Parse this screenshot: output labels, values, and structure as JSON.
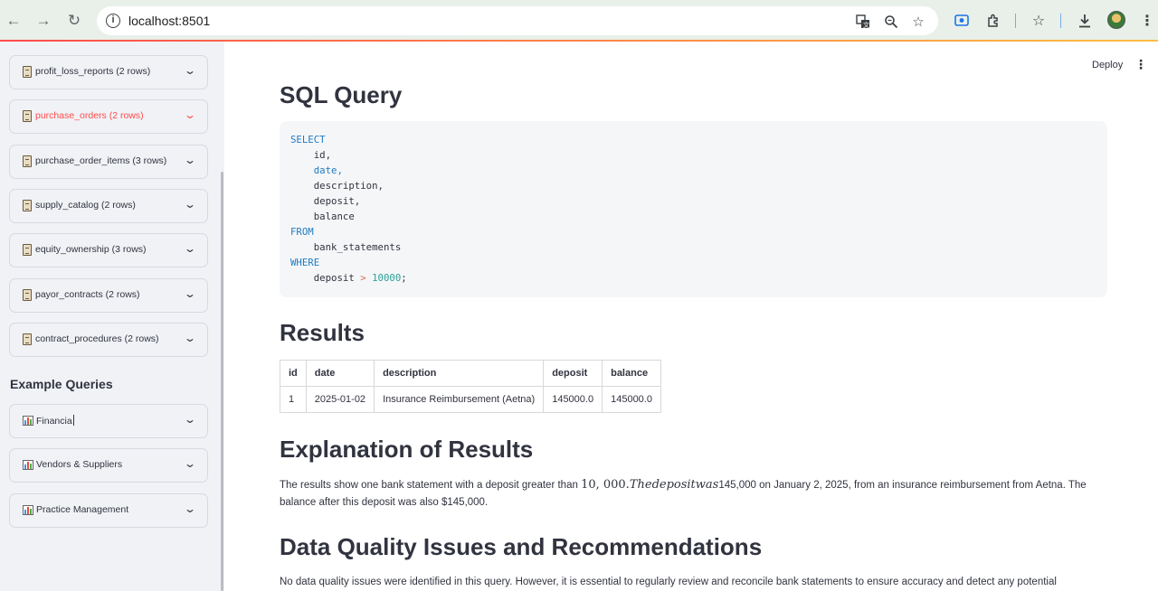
{
  "browser": {
    "url": "localhost:8501"
  },
  "app": {
    "deploy_label": "Deploy",
    "menu_label": "⋮"
  },
  "sidebar": {
    "tables": [
      {
        "label": "profit_loss_reports (2 rows)",
        "active": false
      },
      {
        "label": "purchase_orders (2 rows)",
        "active": true
      },
      {
        "label": "purchase_order_items (3 rows)",
        "active": false
      },
      {
        "label": "supply_catalog (2 rows)",
        "active": false
      },
      {
        "label": "equity_ownership (3 rows)",
        "active": false
      },
      {
        "label": "payor_contracts (2 rows)",
        "active": false
      },
      {
        "label": "contract_procedures (2 rows)",
        "active": false
      }
    ],
    "examples_heading": "Example Queries",
    "examples": [
      {
        "label": "Financia"
      },
      {
        "label": "Vendors & Suppliers"
      },
      {
        "label": "Practice Management"
      }
    ]
  },
  "main": {
    "sql_heading": "SQL Query",
    "sql": {
      "select_kw": "SELECT",
      "columns": [
        "id,",
        "date,",
        "description,",
        "deposit,",
        "balance"
      ],
      "from_kw": "FROM",
      "table": "bank_statements",
      "where_kw": "WHERE",
      "condition_col": "deposit",
      "condition_op": ">",
      "condition_val": "10000",
      "terminator": ";"
    },
    "results_heading": "Results",
    "results": {
      "columns": [
        "id",
        "date",
        "description",
        "deposit",
        "balance"
      ],
      "rows": [
        [
          "1",
          "2025-01-02",
          "Insurance Reimbursement (Aetna)",
          "145000.0",
          "145000.0"
        ]
      ]
    },
    "explanation_heading": "Explanation of Results",
    "explanation": {
      "part1": "The results show one bank statement with a deposit greater than ",
      "math1": "10, 000.",
      "math2": "Thedepositwas",
      "part2": "145,000 on January 2, 2025, from an insurance reimbursement from Aetna. The balance after this deposit was also $145,000."
    },
    "dq_heading": "Data Quality Issues and Recommendations",
    "dq_text": "No data quality issues were identified in this query. However, it is essential to regularly review and reconcile bank statements to ensure accuracy and detect any potential"
  }
}
